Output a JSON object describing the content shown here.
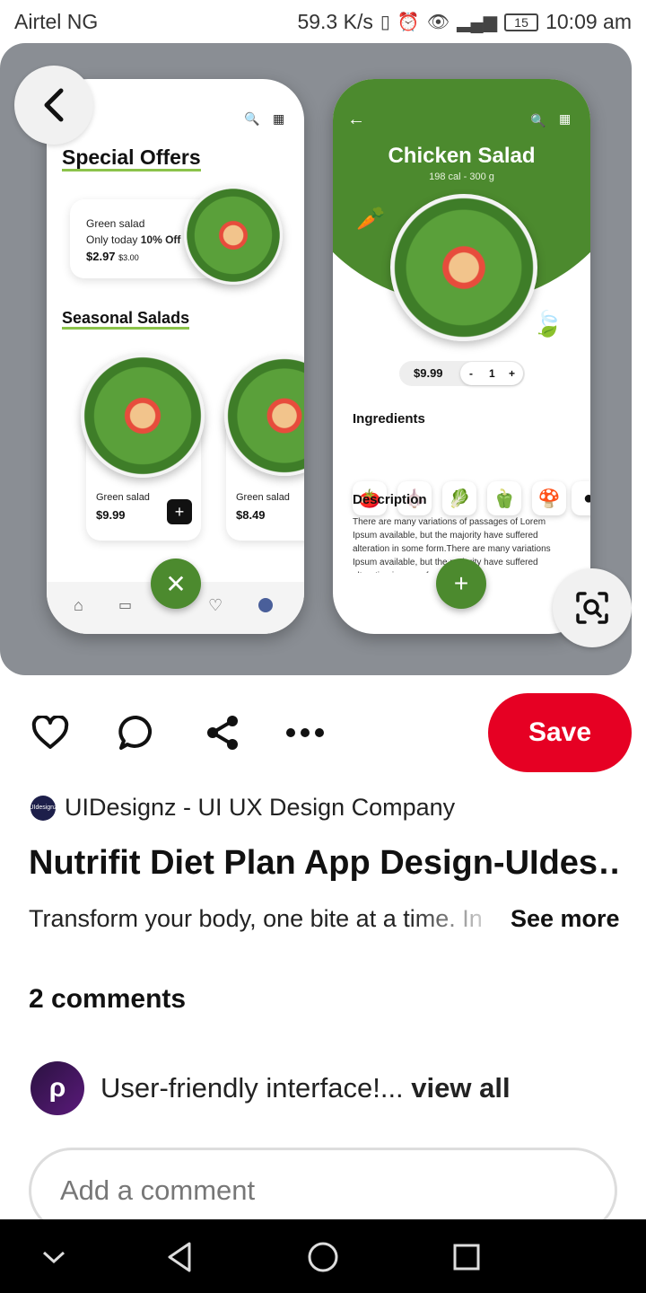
{
  "status_bar": {
    "carrier": "Airtel NG",
    "speed": "59.3 K/s",
    "battery": "15",
    "time": "10:09 am"
  },
  "pin_image": {
    "left_phone": {
      "special_offers_title": "Special Offers",
      "offer": {
        "name": "Green salad",
        "promo_prefix": "Only today",
        "promo_discount": "10% Off",
        "price": "$2.97",
        "old_price": "$3.00"
      },
      "seasonal_title": "Seasonal Salads",
      "items": [
        {
          "name": "Green salad",
          "price": "$9.99"
        },
        {
          "name": "Green salad",
          "price": "$8.49"
        }
      ]
    },
    "right_phone": {
      "title": "Chicken Salad",
      "subtitle": "198 cal - 300 g",
      "price": "$9.99",
      "qty_minus": "-",
      "qty": "1",
      "qty_plus": "+",
      "ingredients_title": "Ingredients",
      "ingredient_icons": [
        "tomato-icon",
        "garlic-icon",
        "lettuce-icon",
        "pepper-icon",
        "mushroom-icon",
        "radish-icon"
      ],
      "description_title": "Description",
      "description_text": "There are many variations of passages of Lorem Ipsum available, but the majority have suffered alteration in some form.There are many variations Ipsum available, but the majority have suffered alteration in some form."
    }
  },
  "actions": {
    "save_label": "Save"
  },
  "creator": {
    "avatar_text": "UIdesignz",
    "name": "UIDesignz - UI UX Design Company"
  },
  "pin": {
    "title": "Nutrifit Diet Plan App Design-UIdes…",
    "description": "Transform your body, one bite at a time. In",
    "see_more": "See more"
  },
  "comments": {
    "count_label": "2 comments",
    "preview_text": "User-friendly interface!...",
    "view_all": "view all",
    "input_placeholder": "Add a comment"
  },
  "colors": {
    "save": "#e60023",
    "accent_green": "#4c8a2e"
  }
}
